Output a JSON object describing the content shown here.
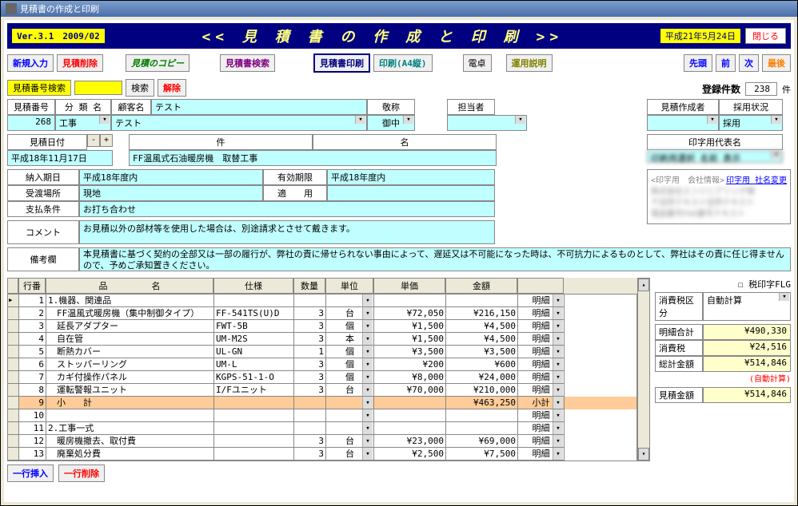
{
  "window": {
    "title": "見積書の作成と印刷"
  },
  "header": {
    "version": "Ver.3.1　2009/02",
    "title": "<< 見 積 書 の 作 成 と 印 刷 >>",
    "date": "平成21年5月24日",
    "close": "閉じる"
  },
  "toolbar": {
    "new_input": "新規入力",
    "estimate_delete": "見積削除",
    "estimate_copy": "見積のコピー",
    "estimate_search": "見積書検索",
    "estimate_print": "見積書印刷",
    "print_a4": "印刷(A4縦)",
    "calculator": "電卓",
    "usage_desc": "運用説明",
    "first": "先頭",
    "prev": "前",
    "next": "次",
    "last": "最後"
  },
  "search": {
    "label": "見積番号検索",
    "search_btn": "検索",
    "cancel_btn": "解除"
  },
  "count": {
    "label": "登録件数",
    "value": "238",
    "unit": "件"
  },
  "form": {
    "estimate_no_label": "見積番号",
    "category_label": "分 類 名",
    "customer_label": "顧客名",
    "honorific_label": "敬称",
    "person_label": "担当者",
    "creator_label": "見積作成者",
    "adoption_label": "採用状況",
    "estimate_no": "268",
    "category": "工事",
    "customer": "テスト",
    "customer2": "テスト",
    "honorific": "御中",
    "adoption": "採用",
    "estimate_date_label": "見積日付",
    "item_label": "件",
    "name_label": "名",
    "print_name_label": "印字用代表名",
    "estimate_date": "平成18年11月17日",
    "item_name": "FF温風式石油暖房機　取替工事",
    "delivery_label": "納入期日",
    "expiry_label": "有効期限",
    "delivery": "平成18年度内",
    "expiry": "平成18年度内",
    "location_label": "受渡場所",
    "application_label": "適　　用",
    "location": "現地",
    "payment_label": "支払条件",
    "payment": "お打ち合わせ",
    "comment_label": "コメント",
    "comment": "お見積以外の部材等を使用した場合は、別途請求とさせて戴きます。",
    "remarks_label": "備考欄",
    "remarks": "本見積書に基づく契約の全部又は一部の履行が、弊社の責に帰せられない事由によって、遅延又は不可能になった時は、不可抗力によるものとして、弊社はその責に任じ得ませんので、予めご承知置きください。",
    "company_info_label": "<印字用　会社情報>",
    "company_change_link": "印字用 社名変更"
  },
  "grid": {
    "headers": {
      "row_no": "行番",
      "item_name": "品　　　　　名",
      "spec": "仕様",
      "qty": "数量",
      "unit": "単位",
      "unit_price": "単価",
      "amount": "金額"
    },
    "rows": [
      {
        "no": "1",
        "name": "1.機器、関連品",
        "spec": "",
        "qty": "",
        "unit": "",
        "price": "",
        "amount": "",
        "detail": "明細"
      },
      {
        "no": "2",
        "name": "　FF温風式暖房機（集中制御タイプ）",
        "spec": "FF-541TS(U)D",
        "qty": "3",
        "unit": "台",
        "price": "¥72,050",
        "amount": "¥216,150",
        "detail": "明細"
      },
      {
        "no": "3",
        "name": "　延長アダプター",
        "spec": "FWT-5B",
        "qty": "3",
        "unit": "個",
        "price": "¥1,500",
        "amount": "¥4,500",
        "detail": "明細"
      },
      {
        "no": "4",
        "name": "　自在管",
        "spec": "UM-M2S",
        "qty": "3",
        "unit": "本",
        "price": "¥1,500",
        "amount": "¥4,500",
        "detail": "明細"
      },
      {
        "no": "5",
        "name": "　断熱カバー",
        "spec": "UL-GN",
        "qty": "1",
        "unit": "個",
        "price": "¥3,500",
        "amount": "¥3,500",
        "detail": "明細"
      },
      {
        "no": "6",
        "name": "　ストッパーリング",
        "spec": "UM-L",
        "qty": "3",
        "unit": "個",
        "price": "¥200",
        "amount": "¥600",
        "detail": "明細"
      },
      {
        "no": "7",
        "name": "　カギ付操作パネル",
        "spec": "KGPS-51-1-O",
        "qty": "3",
        "unit": "個",
        "price": "¥8,000",
        "amount": "¥24,000",
        "detail": "明細"
      },
      {
        "no": "8",
        "name": "　運転警報ユニット",
        "spec": "I/Fユニット",
        "qty": "3",
        "unit": "台",
        "price": "¥70,000",
        "amount": "¥210,000",
        "detail": "明細"
      },
      {
        "no": "9",
        "name": "　小　　計",
        "spec": "",
        "qty": "",
        "unit": "",
        "price": "",
        "amount": "¥463,250",
        "detail": "小計",
        "hl": true
      },
      {
        "no": "10",
        "name": "",
        "spec": "",
        "qty": "",
        "unit": "",
        "price": "",
        "amount": "",
        "detail": "明細"
      },
      {
        "no": "11",
        "name": "2.工事一式",
        "spec": "",
        "qty": "",
        "unit": "",
        "price": "",
        "amount": "",
        "detail": "明細"
      },
      {
        "no": "12",
        "name": "　暖房機撤去、取付費",
        "spec": "",
        "qty": "3",
        "unit": "台",
        "price": "¥23,000",
        "amount": "¥69,000",
        "detail": "明細"
      },
      {
        "no": "13",
        "name": "　廃棄処分費",
        "spec": "",
        "qty": "3",
        "unit": "台",
        "price": "¥2,500",
        "amount": "¥7,500",
        "detail": "明細"
      }
    ],
    "insert_btn": "一行挿入",
    "delete_btn": "一行削除"
  },
  "totals": {
    "tax_flag": "税印字FLG",
    "tax_class_label": "消費税区分",
    "tax_class_value": "自動計算",
    "subtotal_label": "明細合計",
    "subtotal": "¥490,330",
    "tax_label": "消費税",
    "tax": "¥24,516",
    "total_label": "総計金額",
    "total": "¥514,846",
    "auto_calc": "(自動計算)",
    "estimate_amount_label": "見積金額",
    "estimate_amount": "¥514,846"
  }
}
